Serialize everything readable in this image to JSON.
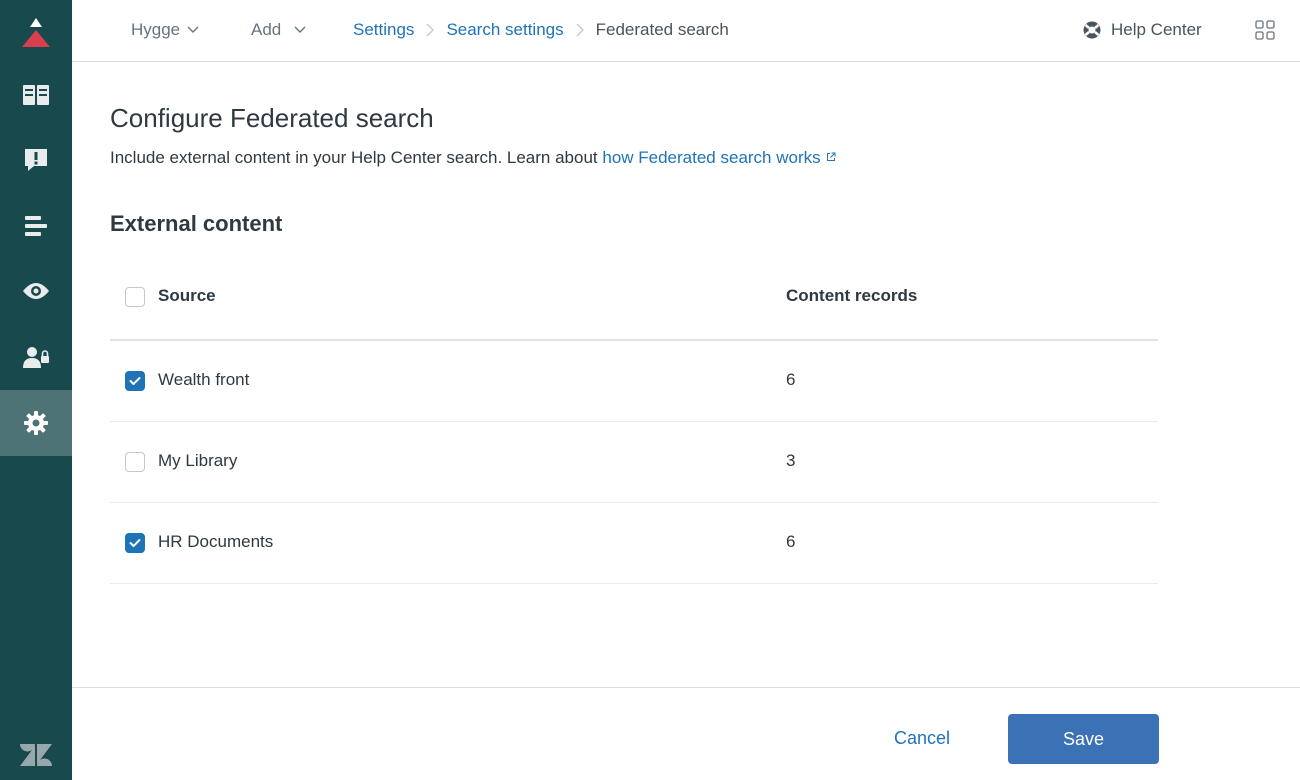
{
  "sidebar": {
    "items": [
      {
        "name": "guide-logo-icon"
      },
      {
        "name": "knowledge-base-icon"
      },
      {
        "name": "community-alert-icon"
      },
      {
        "name": "arrange-content-icon"
      },
      {
        "name": "preview-eye-icon"
      },
      {
        "name": "user-permissions-icon"
      },
      {
        "name": "settings-gear-icon",
        "active": true
      }
    ],
    "footer_icon": "zendesk-logo-icon"
  },
  "topbar": {
    "brand": "Hygge",
    "add": "Add",
    "breadcrumb": [
      "Settings",
      "Search settings",
      "Federated search"
    ],
    "help_center": "Help Center"
  },
  "main": {
    "title": "Configure Federated search",
    "intro_text": "Include external content in your Help Center search. Learn about ",
    "intro_link": "how Federated search works",
    "section_title": "External content",
    "table": {
      "headers": {
        "source": "Source",
        "records": "Content records"
      },
      "rows": [
        {
          "source": "Wealth front",
          "records": "6",
          "checked": true
        },
        {
          "source": "My Library",
          "records": "3",
          "checked": false
        },
        {
          "source": "HR Documents",
          "records": "6",
          "checked": true
        }
      ]
    }
  },
  "footer": {
    "cancel": "Cancel",
    "save": "Save"
  },
  "colors": {
    "sidebar": "#17494d",
    "sidebar_active": "#4d7376",
    "link": "#1f73b7",
    "primary_button": "#3b72b6",
    "logo_red": "#d93f4c"
  }
}
